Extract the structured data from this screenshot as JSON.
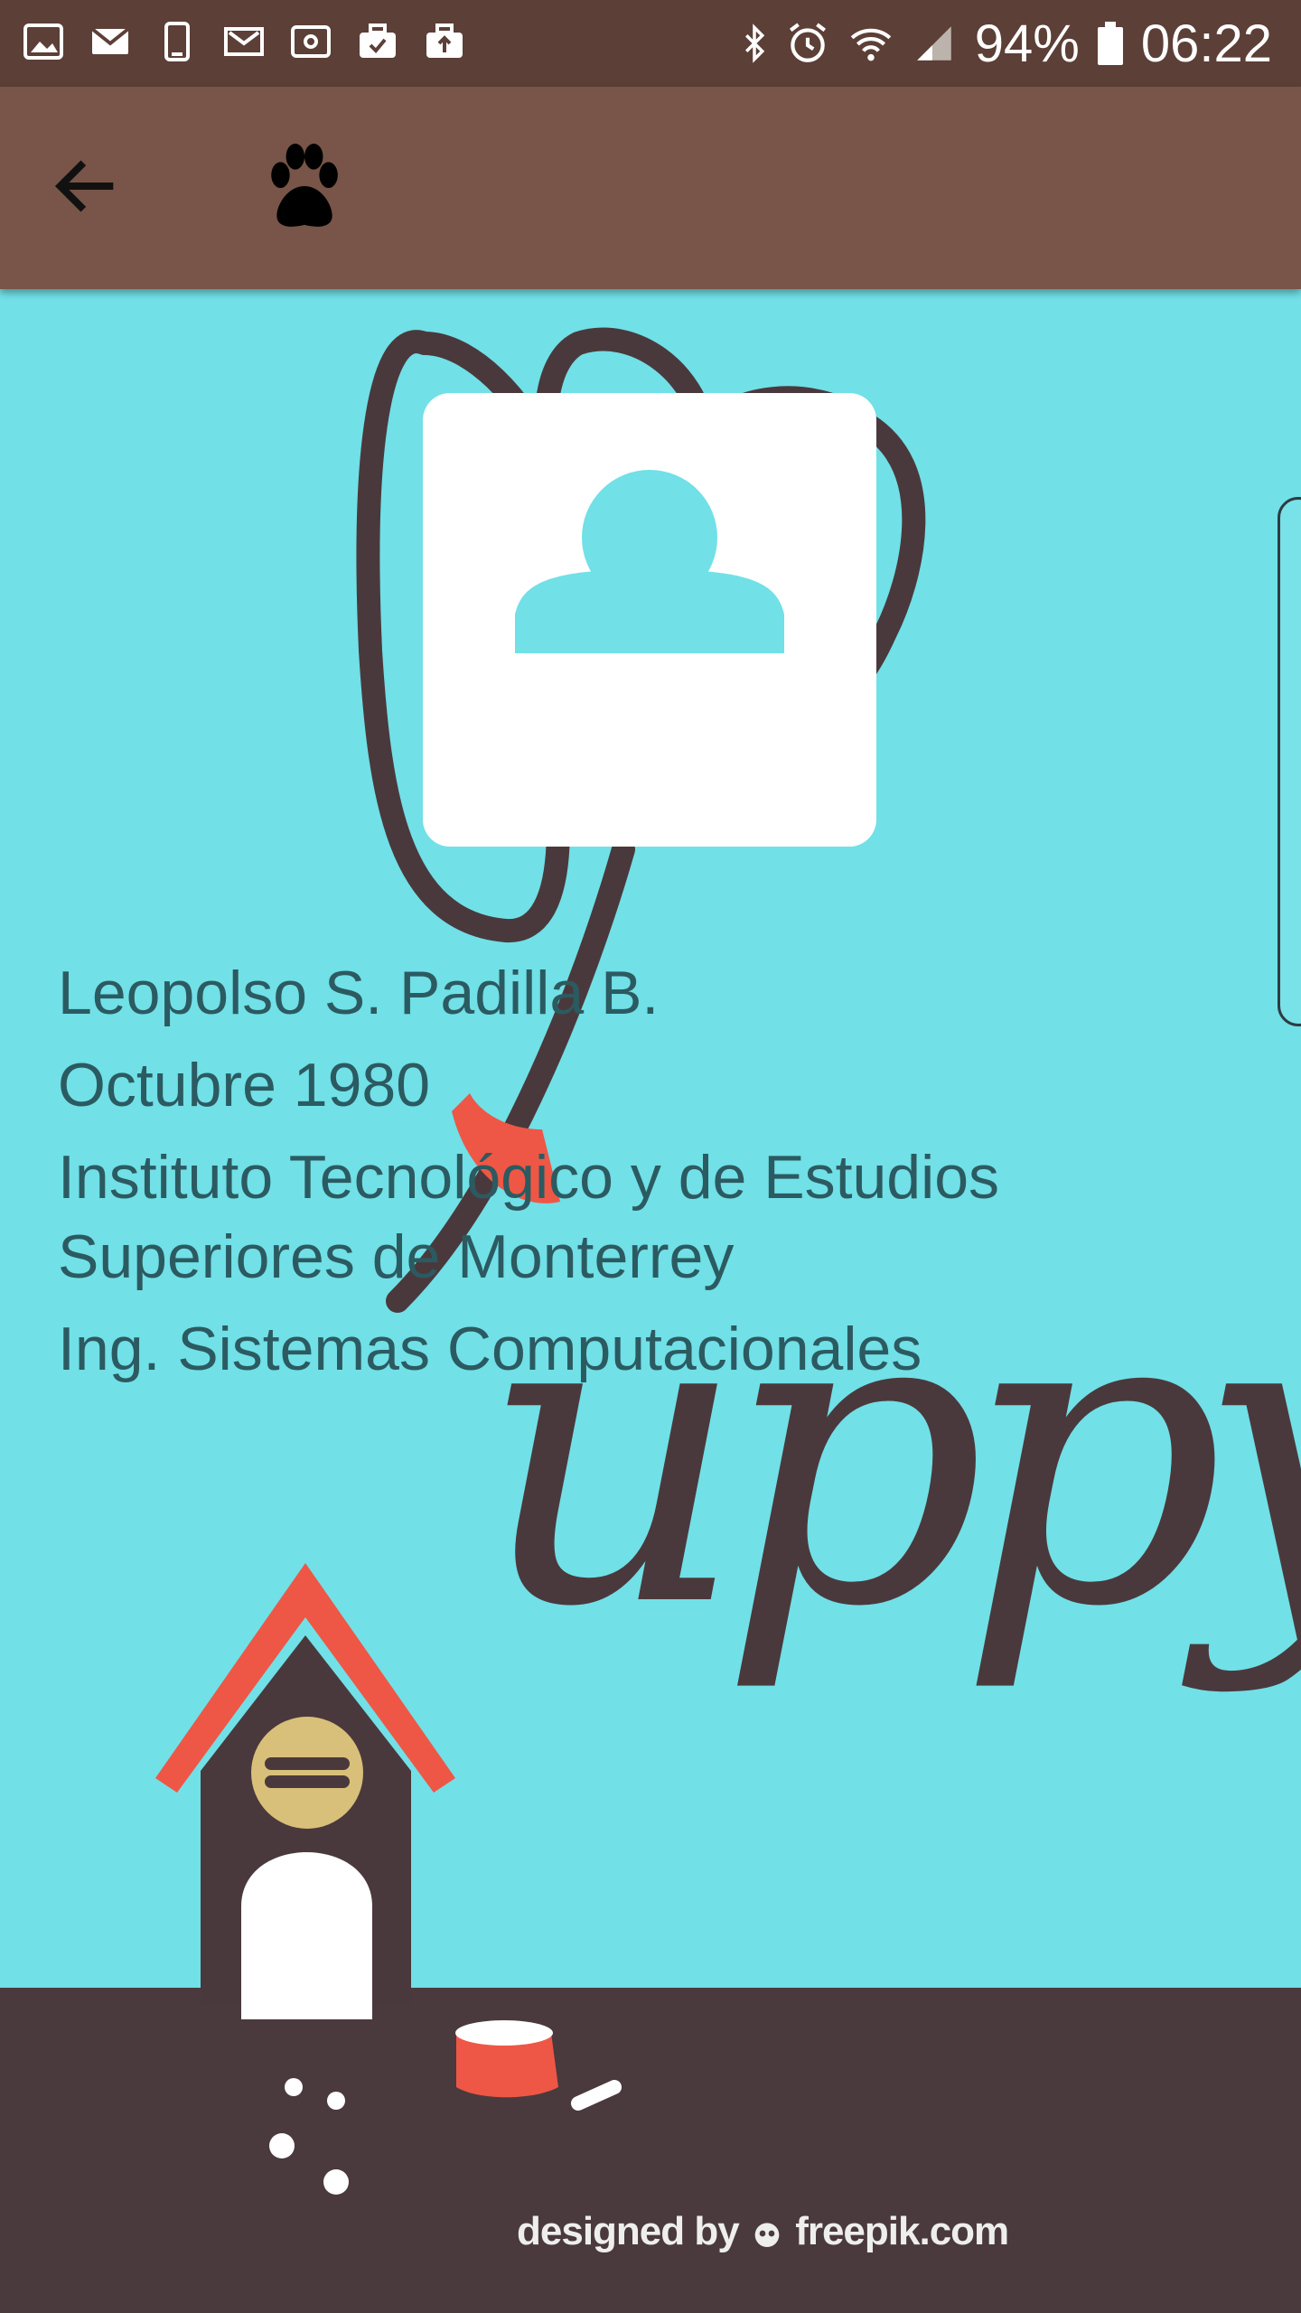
{
  "status_bar": {
    "battery": "94%",
    "time": "06:22"
  },
  "app_bar": {
    "back_icon": "arrow-left-icon",
    "logo_icon": "paw-icon"
  },
  "profile": {
    "name": "Leopolso S. Padilla B.",
    "birth_date": "Octubre 1980",
    "institution": "Instituto Tecnológico y de Estudios Superiores de Monterrey",
    "degree": "Ing. Sistemas Computacionales"
  },
  "background": {
    "logo_text": "uppy",
    "credit_prefix": "designed by",
    "credit_site": "freepik.com"
  },
  "colors": {
    "status_bar": "#5c3f37",
    "app_bar": "#785548",
    "background": "#71e0e7",
    "ground": "#4a3a3d",
    "roof": "#ee5745",
    "text": "#2c5a61"
  }
}
